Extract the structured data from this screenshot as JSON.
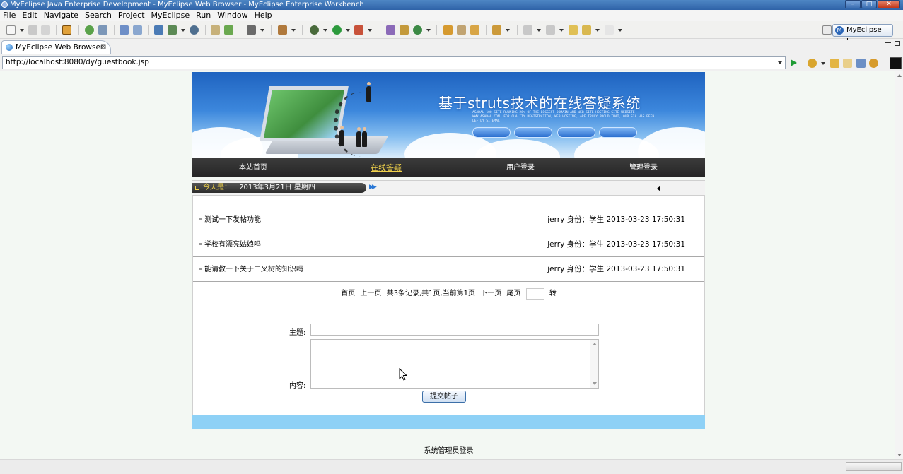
{
  "window": {
    "title": "MyEclipse Java Enterprise Development - MyEclipse Web Browser - MyEclipse Enterprise Workbench",
    "controls": [
      "minimize-icon",
      "maximize-icon",
      "close-icon"
    ]
  },
  "menu": [
    "File",
    "Edit",
    "Navigate",
    "Search",
    "Project",
    "MyEclipse",
    "Run",
    "Window",
    "Help"
  ],
  "perspective_label": "MyEclipse J...",
  "editor_tab": {
    "label": "MyEclipse Web Browser"
  },
  "address": {
    "url": "http://localhost:8080/dy/guestbook.jsp"
  },
  "banner": {
    "title": "基于struts技术的在线答疑系统",
    "subtitle": "ASADAL 100 SITE RUNNING 26% OF THE BIGGEST DOMAIN AND WEB SITE HOSTING SITE WEBSITE WWW.ASADAL.COM. FOR QUALITY REGISTRATION, WEB HOSTING, ARE TRULY PROUD THAT, OUR SIA HAS BEEN LEFTLY SITEMAL"
  },
  "nav": {
    "home": "本站首页",
    "qa": "在线答疑",
    "user_login": "用户登录",
    "admin_login": "管理登录"
  },
  "datebar": {
    "label": "今天是：",
    "date": "2013年3月21日 星期四"
  },
  "posts": [
    {
      "subject": "测试一下发帖功能",
      "meta": "jerry 身份：学生 2013-03-23 17:50:31"
    },
    {
      "subject": "学校有漂亮姑娘吗",
      "meta": "jerry 身份：学生 2013-03-23 17:50:31"
    },
    {
      "subject": "能请教一下关于二叉树的知识吗",
      "meta": "jerry 身份：学生 2013-03-23 17:50:31"
    }
  ],
  "pager": {
    "first": "首页",
    "prev": "上一页",
    "summary": "共3条记录,共1页,当前第1页",
    "next": "下一页",
    "last": "尾页",
    "go": "转"
  },
  "form": {
    "subject_label": "主题:",
    "content_label": "内容:",
    "subject_value": "",
    "content_value": "",
    "submit_label": "提交帖子"
  },
  "footer": {
    "admin_link": "系统管理员登录"
  },
  "colors": {
    "nav_bg": "#2f2f2f",
    "nav_active": "#f0d24b",
    "footer_band": "#8ed1f6",
    "banner_sky": "#3c87dc"
  }
}
